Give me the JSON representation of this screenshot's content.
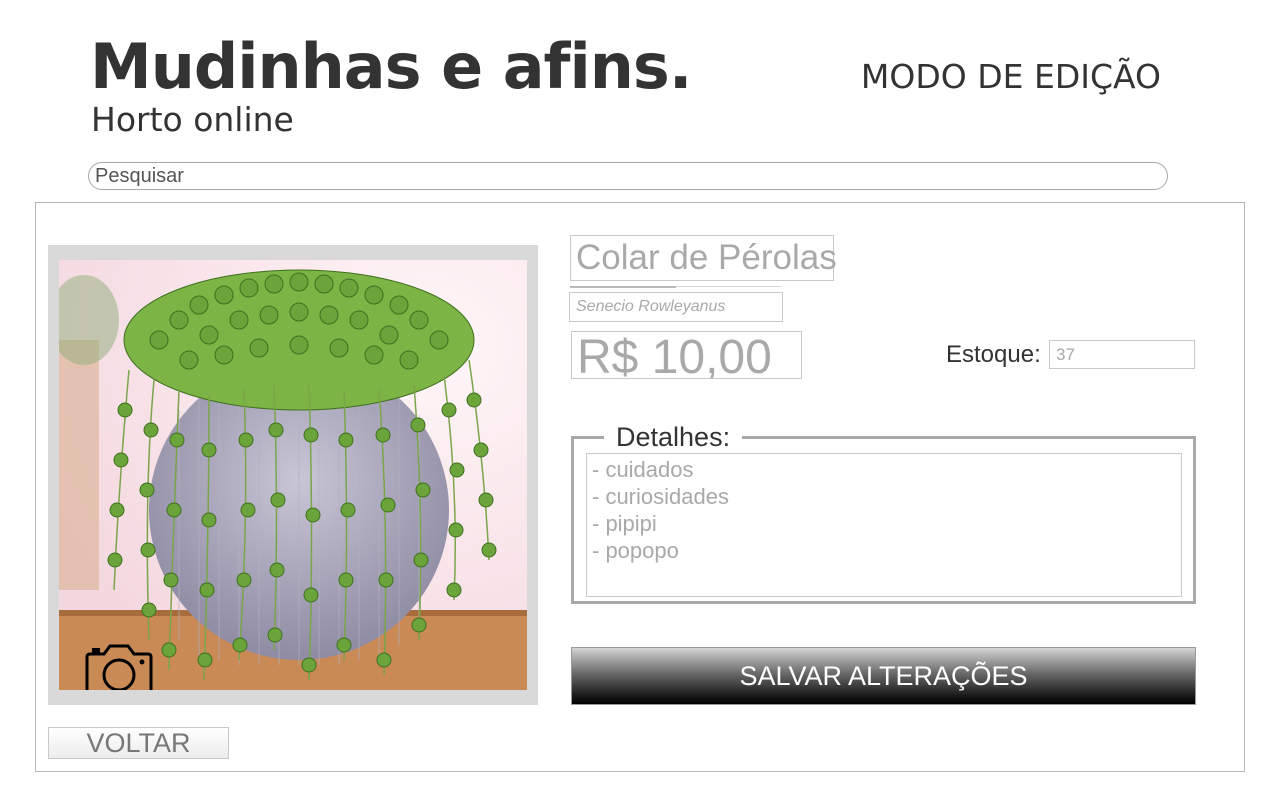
{
  "header": {
    "brand_title": "Mudinhas e afins.",
    "brand_subtitle": "Horto online",
    "mode_label": "MODO DE EDIÇÃO"
  },
  "search": {
    "placeholder": "Pesquisar",
    "value": ""
  },
  "product": {
    "photo_subject": "string-of-pearls plant in gray pot",
    "camera_icon": "camera-icon",
    "name": "Colar de Pérolas",
    "scientific_name": "Senecio Rowleyanus",
    "price": "R$ 10,00",
    "stock_label": "Estoque:",
    "stock_value": "37",
    "details_legend": "Detalhes:",
    "details_lines": [
      "- cuidados",
      "- curiosidades",
      "- pipipi",
      "- popopo"
    ]
  },
  "actions": {
    "save_label": "SALVAR ALTERAÇÕES",
    "back_label": "VOLTAR"
  }
}
